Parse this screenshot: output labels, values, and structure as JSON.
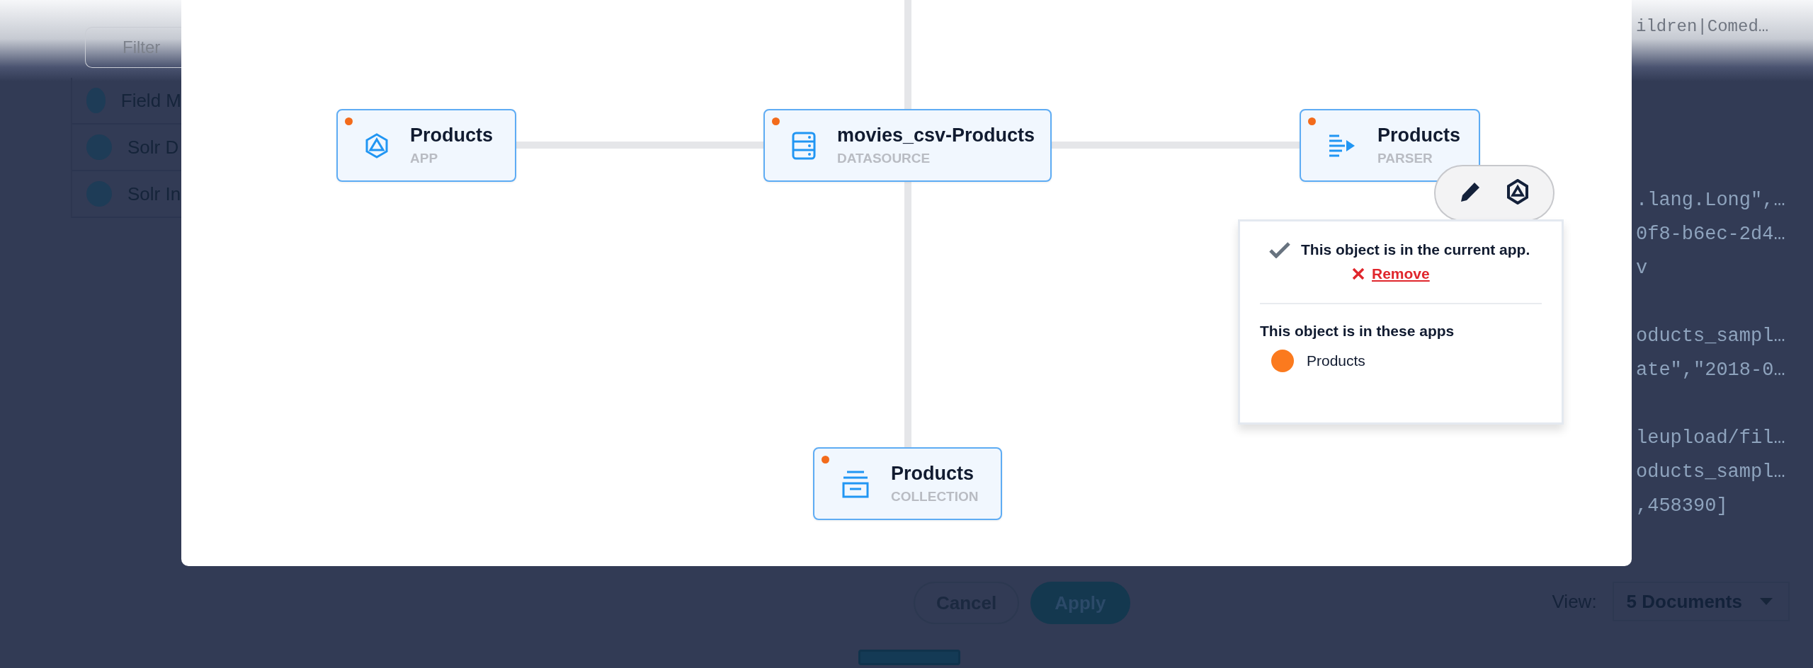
{
  "background": {
    "filter": {
      "placeholder": "Filter"
    },
    "list_items": [
      {
        "label": "Field M"
      },
      {
        "label": "Solr D"
      },
      {
        "label": "Solr In"
      }
    ],
    "header_text": "ildren|Comed…",
    "code_blocks": [
      [
        ".lang.Long\",…",
        "0f8-b6ec-2d4…",
        "v"
      ],
      [
        "oducts_sampl…",
        "ate\",\"2018-0…"
      ],
      [
        "leupload/fil…",
        "oducts_sampl…",
        ",458390]"
      ]
    ],
    "buttons": [
      {
        "label": "Cancel",
        "kind": "secondary"
      },
      {
        "label": "Apply",
        "kind": "primary"
      }
    ],
    "view": {
      "label": "View:",
      "value": "5 Documents"
    }
  },
  "diagram": {
    "nodes": [
      {
        "title": "Products",
        "type_label": "APP",
        "kind": "app"
      },
      {
        "title": "movies_csv-Products",
        "type_label": "DATASOURCE",
        "kind": "datasource"
      },
      {
        "title": "Products",
        "type_label": "PARSER",
        "kind": "parser"
      },
      {
        "title": "Products",
        "type_label": "COLLECTION",
        "kind": "collection"
      }
    ]
  },
  "popover": {
    "status": "This object is in the current app.",
    "remove": "Remove",
    "apps_heading": "This object is in these apps",
    "apps": [
      {
        "name": "Products",
        "color": "#fb7a1e"
      }
    ]
  }
}
